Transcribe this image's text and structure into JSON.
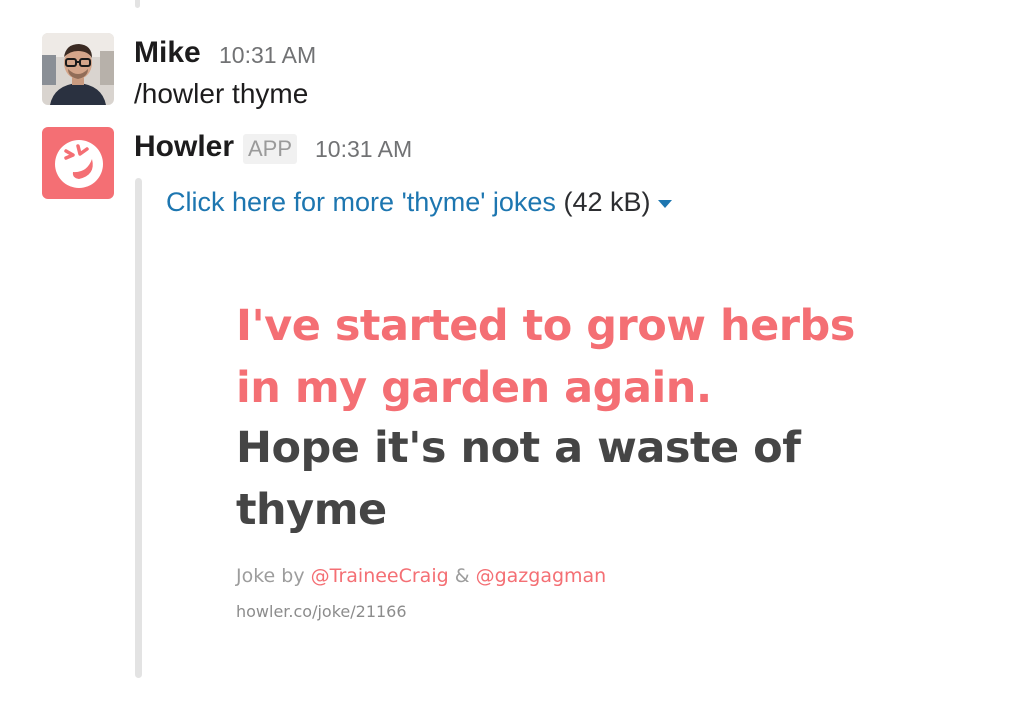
{
  "messages": [
    {
      "sender": "Mike",
      "time": "10:31 AM",
      "text": "/howler thyme"
    },
    {
      "sender": "Howler",
      "badge": "APP",
      "time": "10:31 AM",
      "attachment": {
        "link_text": "Click here for more 'thyme' jokes",
        "size": "(42 kB)",
        "joke_setup_line1": "I've started to grow herbs",
        "joke_setup_line2": "in my garden again.",
        "joke_punch_line1": "Hope it's not a waste of",
        "joke_punch_line2": "thyme",
        "credit_prefix": "Joke by",
        "author1": "@TraineeCraig",
        "credit_joiner": "&",
        "author2": "@gazgagman",
        "url": "howler.co/joke/21166"
      }
    }
  ],
  "colors": {
    "link": "#1d76b0",
    "howler_brand": "#f46f74",
    "punchline": "#454545"
  },
  "icons": {
    "howler_avatar": "laughing-face-icon",
    "attachment_menu": "caret-down-icon"
  }
}
